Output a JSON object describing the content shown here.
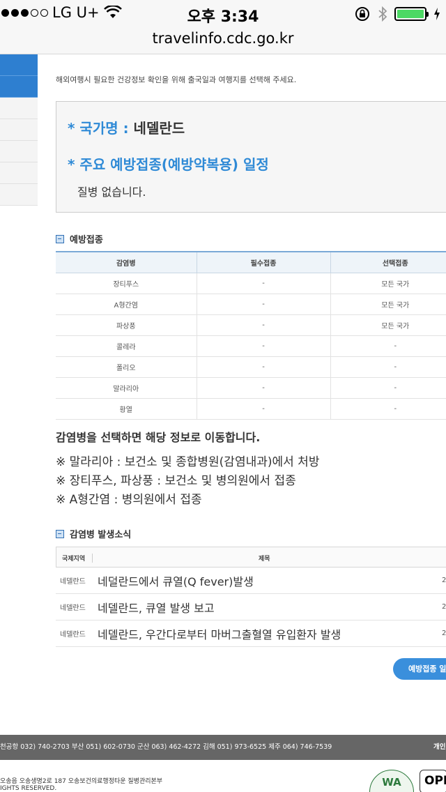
{
  "status_bar": {
    "carrier": "LG U+",
    "time": "오후 3:34",
    "battery_color": "#4cd964"
  },
  "browser": {
    "url": "travelinfo.cdc.go.kr"
  },
  "intro_text": "해외여행시 필요한 건강정보 확인을 위해 출국일과 여행지를 선택해 주세요.",
  "info_box": {
    "country_label": "* 국가명 : ",
    "country_value": "네델란드",
    "schedule_label": "* 주요 예방접종(예방약복용) 일정",
    "schedule_value": "질병 없습니다."
  },
  "vaccination": {
    "title": "예방접종",
    "headers": [
      "감염병",
      "필수접종",
      "선택접종"
    ],
    "rows": [
      [
        "장티푸스",
        "-",
        "모든 국가"
      ],
      [
        "A형간염",
        "-",
        "모든 국가"
      ],
      [
        "파상풍",
        "-",
        "모든 국가"
      ],
      [
        "콜레라",
        "-",
        "-"
      ],
      [
        "폴리오",
        "-",
        "-"
      ],
      [
        "말라리아",
        "-",
        "-"
      ],
      [
        "황열",
        "-",
        "-"
      ]
    ]
  },
  "notice": "감염병을 선택하면 해당 정보로 이동합니다.",
  "notes": [
    "※ 말라리아 : 보건소 및 종합병원(감염내과)에서 처방",
    "※ 장티푸스, 파상풍 : 보건소 및 병의원에서 접종",
    "※ A형간염 : 병의원에서 접종"
  ],
  "news": {
    "title": "감염병 발생소식",
    "headers": [
      "국제지역",
      "제목"
    ],
    "rows": [
      {
        "region": "네델란드",
        "title": "네덜란드에서 큐열(Q fever)발생",
        "date": "2"
      },
      {
        "region": "네델란드",
        "title": "네델란드, 큐열 발생 보고",
        "date": "2"
      },
      {
        "region": "네델란드",
        "title": "네델란드, 우간다로부터 마버그출혈열 유입환자 발생",
        "date": "2"
      }
    ]
  },
  "vacc_button_label": "예방접종 일",
  "footer": {
    "contacts": "천공항 032) 740-2703   부산 051) 602-0730   군산 063) 462-4272   김해 051) 973-6525   제주 064) 746-7539",
    "privacy": "개인",
    "address_line1": "오송읍 오송생명2로 187 오송보건의료행정타운 질병관리본부",
    "address_line2": "IGHTS RESERVED.",
    "wa_logo": "WA",
    "open_logo": "OPE"
  }
}
